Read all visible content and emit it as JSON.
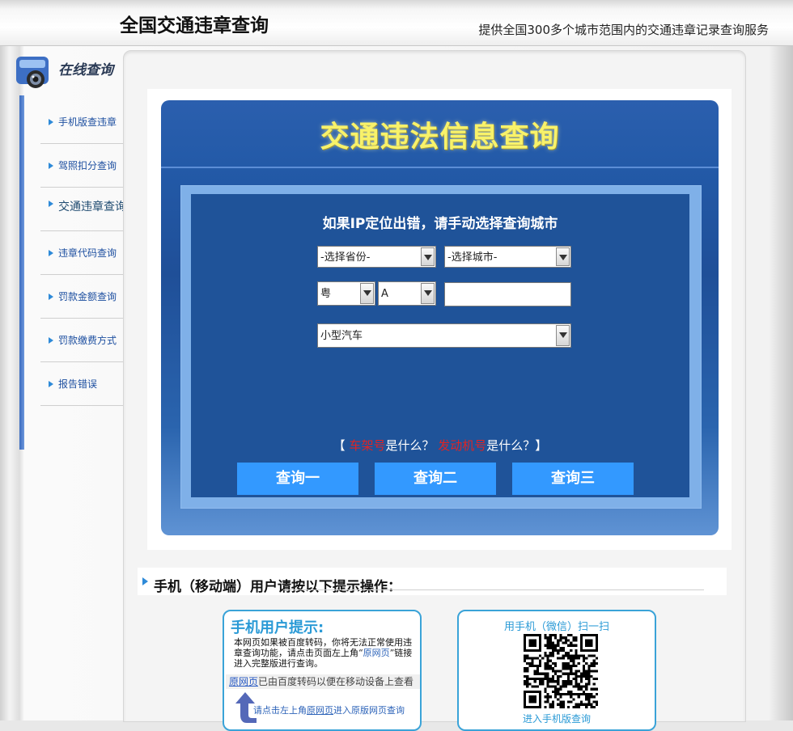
{
  "header": {
    "title": "全国交通违章查询",
    "subtitle": "提供全国300多个城市范围内的交通违章记录查询服务"
  },
  "sidebar": {
    "heading": "在线查询",
    "items": [
      {
        "label": "手机版查违章"
      },
      {
        "label": "驾照扣分查询"
      },
      {
        "label": "交通违章查询"
      },
      {
        "label": "违章代码查询"
      },
      {
        "label": "罚款金额查询"
      },
      {
        "label": "罚款缴费方式"
      },
      {
        "label": "报告错误"
      }
    ]
  },
  "query": {
    "title": "交通违法信息查询",
    "hint": "如果IP定位出错，请手动选择查询城市",
    "province_select": "-选择省份-",
    "city_select": "-选择城市-",
    "plate_prefix": "粤",
    "plate_letter": "A",
    "plate_number": "",
    "vehicle_type": "小型汽车",
    "help": {
      "open": "【",
      "vin_link": "车架号",
      "vin_q": "是什么？",
      "engine_link": "发动机号",
      "engine_q": "是什么？】"
    },
    "buttons": [
      "查询一",
      "查询二",
      "查询三"
    ]
  },
  "mobile": {
    "heading": "手机（移动端）用户请按以下提示操作：",
    "tip_card": {
      "title": "手机用户提示:",
      "body_1": "本网页如果被百度转码，你将无法正常使用违章查询功能，请点击页面左上角“",
      "body_link": "原网页",
      "body_2": "”链接进入完整版进行查询。",
      "bar_link": "原网页",
      "bar_text": "已由百度转码以便在移动设备上查看",
      "foot_1": "请点击左上角",
      "foot_link": "原网页",
      "foot_2": "进入原版网页查询"
    },
    "qr_card": {
      "title": "用手机（微信）扫一扫",
      "footer": "进入手机版查询"
    }
  }
}
